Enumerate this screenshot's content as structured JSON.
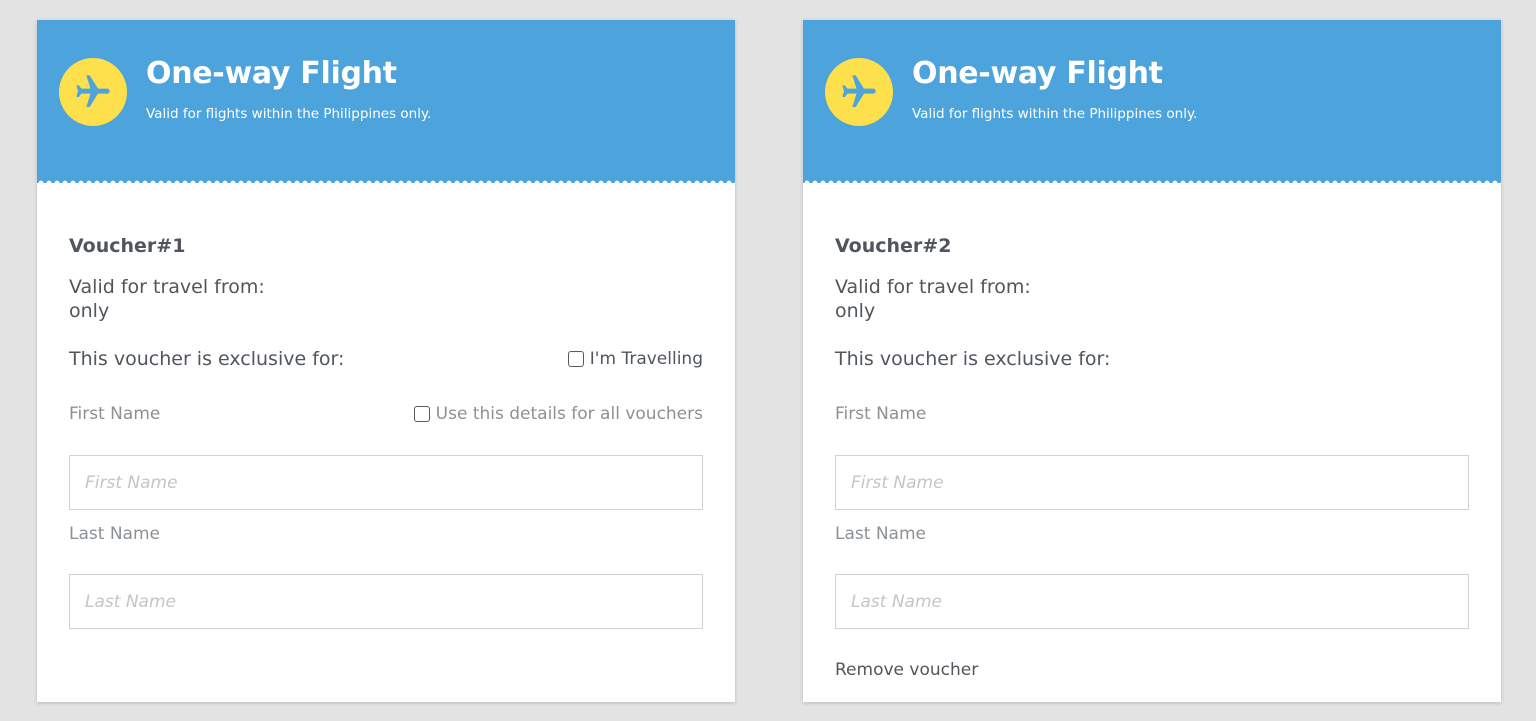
{
  "colors": {
    "header_background": "#4da3db",
    "badge_background": "#fde04b",
    "page_background": "#e3e3e3"
  },
  "cards": [
    {
      "header": {
        "icon": "airplane-icon",
        "title": "One-way Flight",
        "subtitle": "Valid for flights within the Philippines only."
      },
      "voucher_title": "Voucher#1",
      "valid_label": "Valid for travel from:",
      "valid_only": "only",
      "exclusive_label": "This voucher is exclusive for:",
      "travelling_checkbox": {
        "label": "I'm Travelling",
        "checked": false
      },
      "all_vouchers_checkbox": {
        "label": "Use this details for all vouchers",
        "checked": false
      },
      "first_name": {
        "label": "First Name",
        "placeholder": "First Name",
        "value": ""
      },
      "last_name": {
        "label": "Last Name",
        "placeholder": "Last Name",
        "value": ""
      }
    },
    {
      "header": {
        "icon": "airplane-icon",
        "title": "One-way Flight",
        "subtitle": "Valid for flights within the Philippines only."
      },
      "voucher_title": "Voucher#2",
      "valid_label": "Valid for travel from:",
      "valid_only": "only",
      "exclusive_label": "This voucher is exclusive for:",
      "first_name": {
        "label": "First Name",
        "placeholder": "First Name",
        "value": ""
      },
      "last_name": {
        "label": "Last Name",
        "placeholder": "Last Name",
        "value": ""
      },
      "remove_label": "Remove voucher"
    }
  ]
}
